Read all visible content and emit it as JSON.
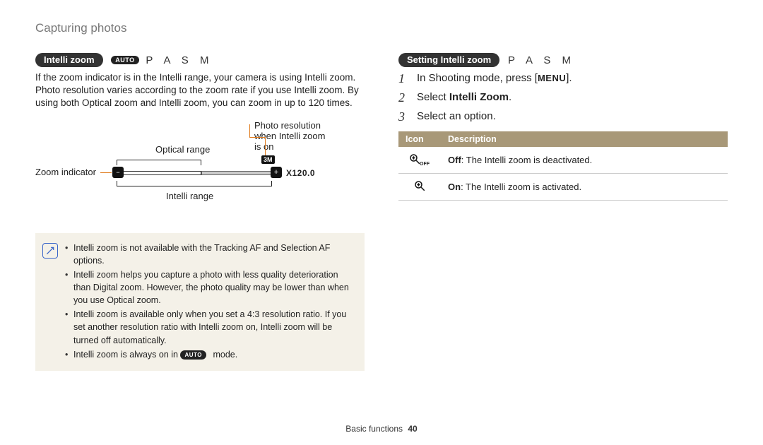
{
  "page_title": "Capturing photos",
  "left": {
    "pill": "Intelli zoom",
    "auto_badge": "AUTO",
    "modes": "P A S M",
    "body": "If the zoom indicator is in the Intelli range, your camera is using Intelli zoom. Photo resolution varies according to the zoom rate if you use Intelli zoom. By using both Optical zoom and Intelli zoom, you can zoom in up to 120 times.",
    "diagram": {
      "zoom_indicator": "Zoom indicator",
      "optical_range": "Optical range",
      "intelli_range": "Intelli range",
      "photo_res_label_1": "Photo resolution",
      "photo_res_label_2": "when Intelli zoom",
      "photo_res_label_3": "is on",
      "res_badge": "3M",
      "readout": "X120.0"
    },
    "notes": [
      "Intelli zoom is not available with the Tracking AF and Selection AF options.",
      "Intelli zoom helps you capture a photo with less quality deterioration than Digital zoom. However, the photo quality may be lower than when you use Optical zoom.",
      "Intelli zoom is available only when you set a 4:3 resolution ratio. If you set another resolution ratio with Intelli zoom on, Intelli zoom will be turned off automatically.",
      "Intelli zoom is always on in AUTO mode."
    ],
    "note_auto_inline": "AUTO"
  },
  "right": {
    "pill": "Setting Intelli zoom",
    "modes": "P A S M",
    "steps": [
      {
        "pre": "In Shooting mode, press [",
        "key": "MENU",
        "post": "]."
      },
      {
        "pre": "Select ",
        "bold": "Intelli Zoom",
        "post": "."
      },
      {
        "pre": "Select an option.",
        "key": "",
        "post": ""
      }
    ],
    "table": {
      "h1": "Icon",
      "h2": "Description",
      "rows": [
        {
          "bold": "Off",
          "text": ": The Intelli zoom is deactivated."
        },
        {
          "bold": "On",
          "text": ": The Intelli zoom is activated."
        }
      ]
    }
  },
  "footer": {
    "section": "Basic functions",
    "page": "40"
  }
}
